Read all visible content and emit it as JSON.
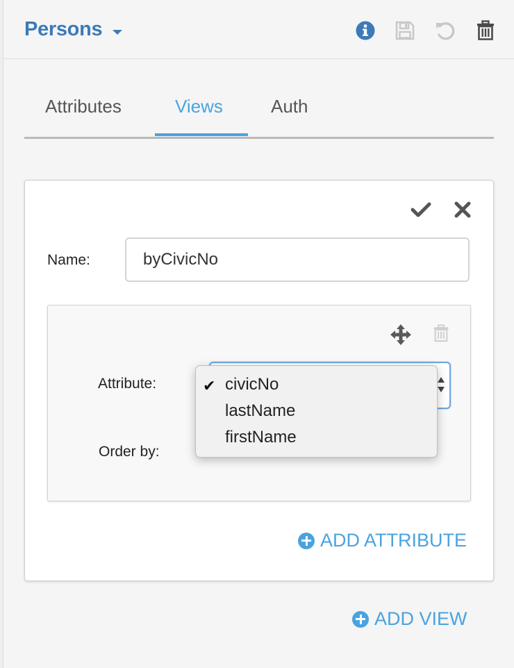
{
  "header": {
    "title": "Persons",
    "icons": [
      "chevron-down-icon",
      "info-icon",
      "save-icon",
      "undo-icon",
      "trash-icon"
    ]
  },
  "tabs": [
    {
      "label": "Attributes",
      "active": false
    },
    {
      "label": "Views",
      "active": true
    },
    {
      "label": "Auth",
      "active": false
    }
  ],
  "view": {
    "name_label": "Name:",
    "name_value": "byCivicNo",
    "attribute_label": "Attribute:",
    "order_by_label": "Order by:",
    "attribute_options": [
      "civicNo",
      "lastName",
      "firstName"
    ],
    "attribute_selected": "civicNo",
    "add_attribute_label": "ADD ATTRIBUTE"
  },
  "add_view_label": "ADD VIEW",
  "colors": {
    "accent": "#4aa3df",
    "title": "#3d7ab8",
    "panel_bg": "#f5f5f5"
  }
}
